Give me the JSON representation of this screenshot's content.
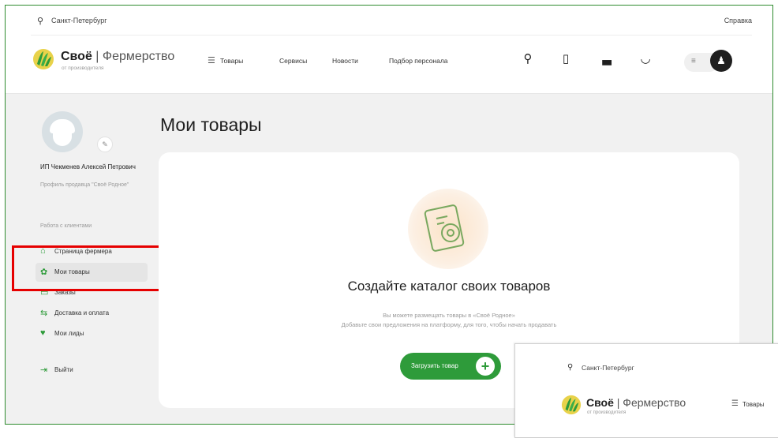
{
  "header": {
    "city": "Санкт-Петербург",
    "help": "Справка",
    "brand_bold": "Своё",
    "brand_sep": " | ",
    "brand_thin": "Фермерство",
    "tagline": "от производителя",
    "nav": [
      "Товары",
      "Сервисы",
      "Новости",
      "Подбор персонала"
    ]
  },
  "sidebar": {
    "profile_name": "ИП Чекменев Алексей Петрович",
    "profile_sub": "Профиль продавца \"Своё Родное\"",
    "section_label": "Работа с клиентами",
    "items": [
      {
        "label": "Страница фермера",
        "icon": "⌂"
      },
      {
        "label": "Мои товары",
        "icon": "✿"
      },
      {
        "label": "Заказы",
        "icon": "▭"
      },
      {
        "label": "Доставка и оплата",
        "icon": "⇆"
      },
      {
        "label": "Мои лиды",
        "icon": "♥"
      }
    ],
    "logout": "Выйти"
  },
  "main": {
    "title": "Мои товары",
    "empty_title": "Создайте каталог своих товаров",
    "empty_desc1": "Вы можете размещать товары в «Своё Родное»",
    "empty_desc2": "Добавьте свои предложения на платформу, для того, чтобы начать продавать",
    "upload_button": "Загрузить товар",
    "upload_plus": "+"
  },
  "inset": {
    "city": "Санкт-Петербург",
    "brand_bold": "Своё",
    "brand_sep": " | ",
    "brand_thin": "Фермерство",
    "tagline": "от производителя",
    "nav_first": "Товары"
  },
  "colors": {
    "accent_green": "#2e9b3a",
    "highlight_red": "#e60000",
    "page_bg": "#f1f1f1"
  }
}
